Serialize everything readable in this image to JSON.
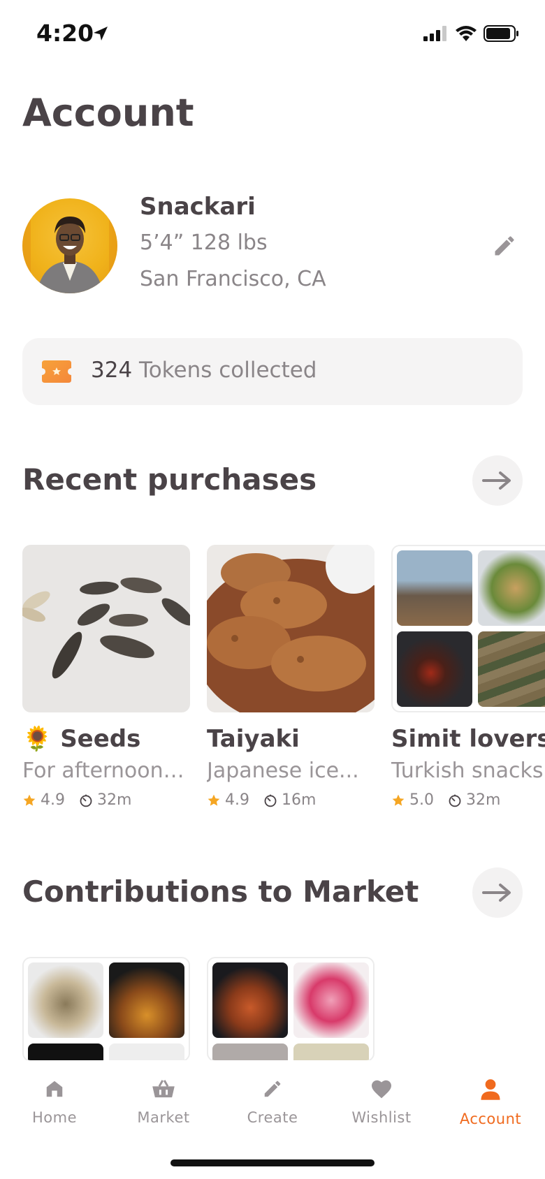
{
  "status": {
    "time": "4:20"
  },
  "page": {
    "title": "Account"
  },
  "profile": {
    "name": "Snackari",
    "stats": "5’4”  128 lbs",
    "location": "San Francisco, CA"
  },
  "tokens": {
    "count": "324",
    "label": " Tokens collected"
  },
  "recent": {
    "heading": "Recent purchases",
    "items": [
      {
        "emoji": "🌻",
        "title": "Seeds",
        "subtitle": "For afternoon t...",
        "rating": "4.9",
        "time": "32m"
      },
      {
        "emoji": "",
        "title": "Taiyaki",
        "subtitle": "Japanese ice...",
        "rating": "4.9",
        "time": "16m"
      },
      {
        "emoji": "",
        "title": "Simit lovers",
        "subtitle": "Turkish snacks",
        "rating": "5.0",
        "time": "32m"
      }
    ]
  },
  "contributions": {
    "heading": "Contributions to Market"
  },
  "tabs": [
    {
      "label": "Home",
      "icon": "home-icon"
    },
    {
      "label": "Market",
      "icon": "basket-icon"
    },
    {
      "label": "Create",
      "icon": "pencil-icon"
    },
    {
      "label": "Wishlist",
      "icon": "heart-icon"
    },
    {
      "label": "Account",
      "icon": "person-icon",
      "active": true
    }
  ],
  "colors": {
    "accent": "#f06a1e",
    "text": "#4a4347",
    "muted": "#9a9598",
    "star": "#f5a623"
  }
}
